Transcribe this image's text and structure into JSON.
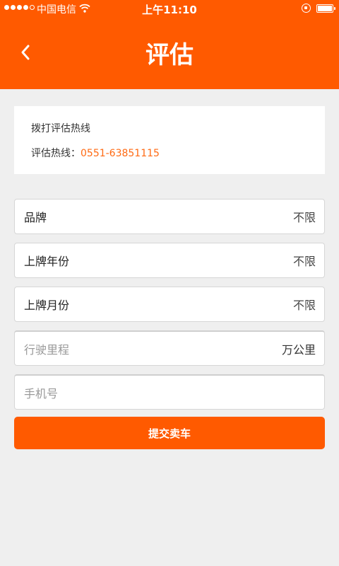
{
  "status_bar": {
    "carrier": "中国电信",
    "time": "上午11:10"
  },
  "header": {
    "title": "评估",
    "back_icon": "chevron-left-icon"
  },
  "hotline": {
    "heading": "拨打评估热线",
    "label": "评估热线：",
    "number": "0551-63851115"
  },
  "form": {
    "brand": {
      "label": "品牌",
      "value": "不限"
    },
    "reg_year": {
      "label": "上牌年份",
      "value": "不限"
    },
    "reg_month": {
      "label": "上牌月份",
      "value": "不限"
    },
    "mileage": {
      "placeholder": "行驶里程",
      "unit": "万公里"
    },
    "phone": {
      "placeholder": "手机号"
    },
    "submit_label": "提交卖车"
  },
  "colors": {
    "accent": "#ff5a00",
    "link": "#ff6a13",
    "background": "#efefef"
  }
}
